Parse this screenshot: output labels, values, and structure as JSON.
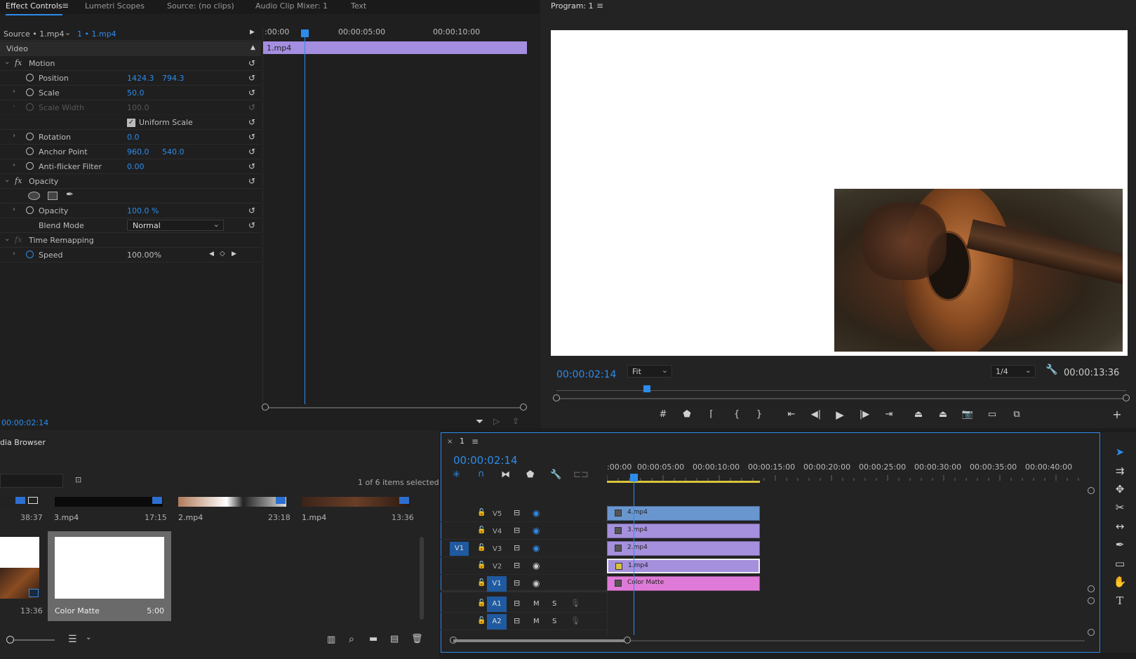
{
  "tabs": {
    "effect_controls": "Effect Controls",
    "lumetri": "Lumetri Scopes",
    "source": "Source: (no clips)",
    "audio_mixer": "Audio Clip Mixer: 1",
    "text": "Text",
    "program": "Program: 1"
  },
  "ec": {
    "source_label": "Source • 1.mp4",
    "clip_label": "1 • 1.mp4",
    "section": "Video",
    "motion": "Motion",
    "position_label": "Position",
    "position_x": "1424.3",
    "position_y": "794.3",
    "scale_label": "Scale",
    "scale_val": "50.0",
    "scale_width_label": "Scale Width",
    "scale_width_val": "100.0",
    "uniform_scale": "Uniform Scale",
    "rotation_label": "Rotation",
    "rotation_val": "0.0",
    "anchor_label": "Anchor Point",
    "anchor_x": "960.0",
    "anchor_y": "540.0",
    "antiflicker_label": "Anti-flicker Filter",
    "antiflicker_val": "0.00",
    "opacity_group": "Opacity",
    "opacity_label": "Opacity",
    "opacity_val": "100.0 %",
    "blend_label": "Blend Mode",
    "blend_val": "Normal",
    "time_remap": "Time Remapping",
    "speed_label": "Speed",
    "speed_val": "100.00%",
    "timecode": "00:00:02:14",
    "mini_tl": {
      "t0": ":00:00",
      "t1": "00:00:05:00",
      "t2": "00:00:10:00",
      "clip": "1.mp4"
    }
  },
  "program": {
    "timecode": "00:00:02:14",
    "fit": "Fit",
    "quality": "1/4",
    "duration": "00:00:13:36"
  },
  "media": {
    "tab": "dia Browser",
    "selected": "1 of 6 items selected",
    "items": [
      {
        "name": "",
        "dur": "38:37"
      },
      {
        "name": "3.mp4",
        "dur": "17:15"
      },
      {
        "name": "2.mp4",
        "dur": "23:18"
      },
      {
        "name": "1.mp4",
        "dur": "13:36"
      }
    ],
    "row2": [
      {
        "name": "",
        "dur": "13:36"
      },
      {
        "name": "Color Matte",
        "dur": "5:00"
      }
    ]
  },
  "timeline": {
    "seq": "1",
    "timecode": "00:00:02:14",
    "ruler": [
      ":00:00",
      "00:00:05:00",
      "00:00:10:00",
      "00:00:15:00",
      "00:00:20:00",
      "00:00:25:00",
      "00:00:30:00",
      "00:00:35:00",
      "00:00:40:00"
    ],
    "tracks": [
      {
        "name": "V5",
        "clip": "4.mp4",
        "color": "#6a96d0"
      },
      {
        "name": "V4",
        "clip": "3.mp4",
        "color": "#a590dd"
      },
      {
        "name": "V3",
        "clip": "2.mp4",
        "color": "#a590dd"
      },
      {
        "name": "V2",
        "clip": "1.mp4",
        "color": "#a590dd"
      },
      {
        "name": "V1",
        "clip": "Color Matte",
        "color": "#e07ad8"
      }
    ],
    "audio": [
      {
        "name": "A1",
        "m": "M",
        "s": "S"
      },
      {
        "name": "A2",
        "m": "M",
        "s": "S"
      }
    ],
    "src_patch": "V1"
  }
}
